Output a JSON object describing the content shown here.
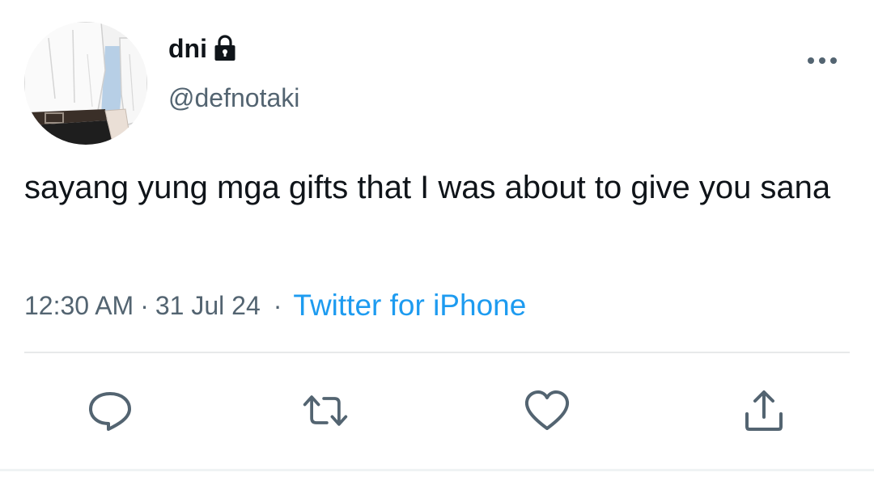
{
  "user": {
    "display_name": "dni",
    "handle": "@defnotaki",
    "avatar_icon": "avatar-photo-icon",
    "protected_icon": "lock-icon"
  },
  "tweet": {
    "text": "sayang yung mga gifts that I was about to give you sana",
    "time": "12:30 AM",
    "separator": "·",
    "date": "31 Jul 24",
    "source": "Twitter for iPhone"
  },
  "actions": [
    {
      "name": "reply",
      "icon": "reply-icon"
    },
    {
      "name": "retweet",
      "icon": "retweet-icon"
    },
    {
      "name": "like",
      "icon": "heart-icon"
    },
    {
      "name": "share",
      "icon": "share-icon"
    }
  ],
  "colors": {
    "text": "#0f1419",
    "secondary": "#536471",
    "link": "#1d9bf0",
    "divider": "#e7e9ea"
  }
}
